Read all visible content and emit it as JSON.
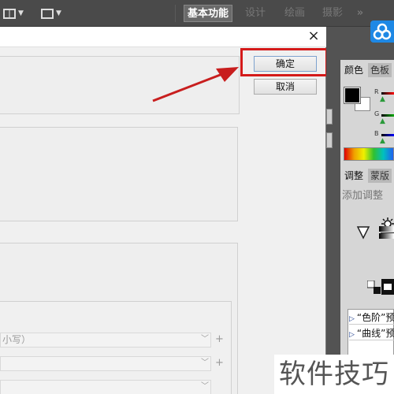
{
  "toolbar": {
    "workspaces": [
      "基本功能",
      "设计",
      "绘画",
      "摄影"
    ],
    "more": "»",
    "active_workspace": "基本功能"
  },
  "dialog": {
    "close_glyph": "×",
    "ok_label": "确定",
    "cancel_label": "取消",
    "field1_text": "小写）",
    "plus": "+"
  },
  "panel": {
    "tabs_top": [
      "颜色",
      "色板"
    ],
    "channels": [
      "R",
      "G",
      "B"
    ],
    "tabs_adj": [
      "调整",
      "蒙版"
    ],
    "add_adjustment": "添加调整",
    "presets": [
      "“色阶”预",
      "“曲线”预"
    ]
  },
  "watermark": "软件技巧",
  "colors": {
    "highlight": "#d41a1a",
    "cloud_icon": "#1e88e5"
  },
  "icons": [
    "layout-grid-icon",
    "screen-mode-icon",
    "cloud-icon",
    "close-icon",
    "brightness-icon",
    "levels-icon",
    "gradient-icon",
    "vibrance-icon",
    "black-white-icon"
  ]
}
